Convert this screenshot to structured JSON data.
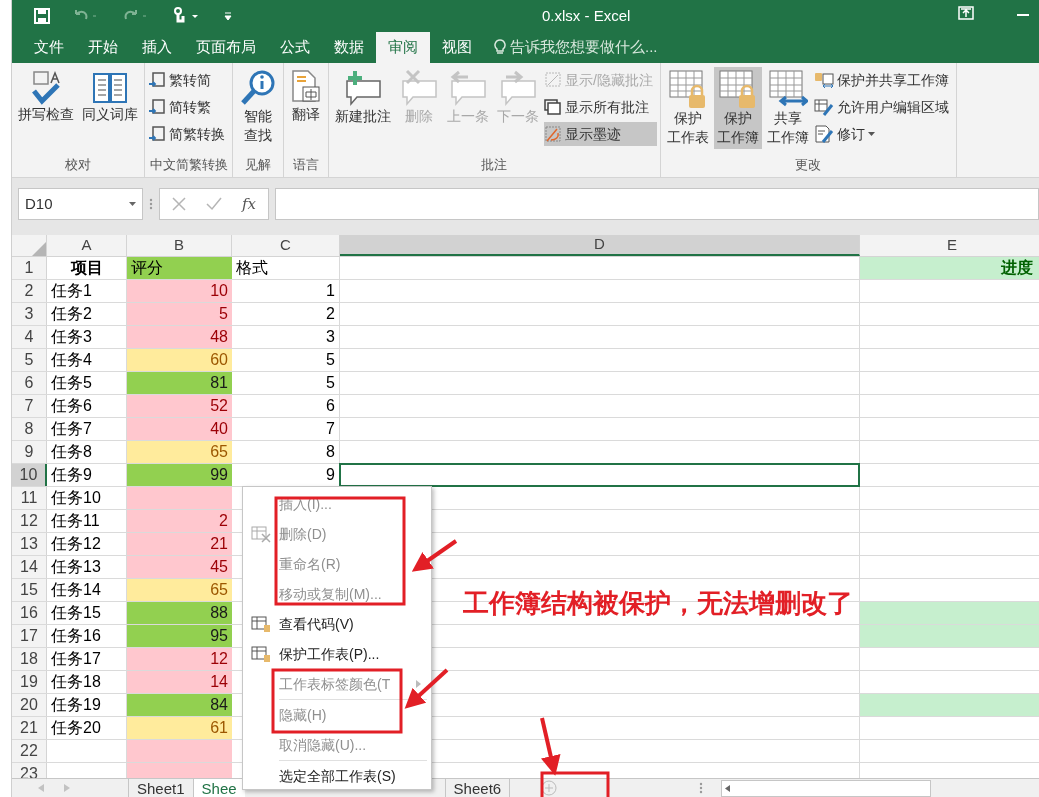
{
  "window": {
    "title": "0.xlsx - Excel"
  },
  "menu_tabs": [
    {
      "label": "文件",
      "selected": false
    },
    {
      "label": "开始",
      "selected": false
    },
    {
      "label": "插入",
      "selected": false
    },
    {
      "label": "页面布局",
      "selected": false
    },
    {
      "label": "公式",
      "selected": false
    },
    {
      "label": "数据",
      "selected": false
    },
    {
      "label": "审阅",
      "selected": true
    },
    {
      "label": "视图",
      "selected": false
    }
  ],
  "tell_me": {
    "placeholder": "告诉我您想要做什么..."
  },
  "ribbon_groups": [
    {
      "label": "校对",
      "buttons": [
        {
          "label": "拼写检查",
          "kind": "large",
          "disabled": false,
          "selected": false
        },
        {
          "label": "同义词库",
          "kind": "large",
          "disabled": false,
          "selected": false
        }
      ]
    },
    {
      "label": "中文简繁转换",
      "buttons": [
        {
          "label": "繁转简",
          "kind": "small",
          "disabled": false,
          "selected": false
        },
        {
          "label": "简转繁",
          "kind": "small",
          "disabled": false,
          "selected": false
        },
        {
          "label": "简繁转换",
          "kind": "small",
          "disabled": false,
          "selected": false
        }
      ]
    },
    {
      "label": "见解",
      "buttons": [
        {
          "label_lines": [
            "智能",
            "查找"
          ],
          "kind": "large",
          "disabled": false,
          "selected": false
        }
      ]
    },
    {
      "label": "语言",
      "buttons": [
        {
          "label": "翻译",
          "kind": "large",
          "disabled": false,
          "selected": false
        }
      ]
    },
    {
      "label": "批注",
      "buttons": [
        {
          "label": "新建批注",
          "kind": "large",
          "disabled": false,
          "selected": false
        },
        {
          "label": "删除",
          "kind": "large",
          "disabled": true,
          "selected": false
        },
        {
          "label": "上一条",
          "kind": "large",
          "disabled": true,
          "selected": false
        },
        {
          "label": "下一条",
          "kind": "large",
          "disabled": true,
          "selected": false
        },
        {
          "label": "显示/隐藏批注",
          "kind": "small",
          "disabled": true,
          "selected": false
        },
        {
          "label": "显示所有批注",
          "kind": "small",
          "disabled": false,
          "selected": false
        },
        {
          "label": "显示墨迹",
          "kind": "small",
          "disabled": false,
          "selected": true
        }
      ]
    },
    {
      "label": "更改",
      "buttons": [
        {
          "label_lines": [
            "保护",
            "工作表"
          ],
          "kind": "large",
          "disabled": false,
          "selected": false
        },
        {
          "label_lines": [
            "保护",
            "工作簿"
          ],
          "kind": "large",
          "disabled": false,
          "selected": true
        },
        {
          "label_lines": [
            "共享",
            "工作簿"
          ],
          "kind": "large",
          "disabled": false,
          "selected": false
        },
        {
          "label": "保护并共享工作簿",
          "kind": "small",
          "disabled": false,
          "selected": false
        },
        {
          "label": "允许用户编辑区域",
          "kind": "small",
          "disabled": false,
          "selected": false
        },
        {
          "label": "修订",
          "kind": "small-menu",
          "disabled": false,
          "selected": false
        }
      ]
    }
  ],
  "formula_bar": {
    "name_box": "D10",
    "fx": "fx"
  },
  "columns": [
    {
      "label": "A",
      "selected": false
    },
    {
      "label": "B",
      "selected": false
    },
    {
      "label": "C",
      "selected": false
    },
    {
      "label": "D",
      "selected": true
    },
    {
      "label": "E",
      "selected": false
    }
  ],
  "header_row": {
    "num": "1",
    "a": "项目",
    "b": "评分",
    "c": "格式",
    "e": "进度"
  },
  "rows": [
    {
      "num": "2",
      "name": "任务1",
      "score": "10",
      "color": "#ffc7ce",
      "format": "1",
      "e_filled": false,
      "selected": false
    },
    {
      "num": "3",
      "name": "任务2",
      "score": "5",
      "color": "#ffc7ce",
      "format": "2",
      "e_filled": false,
      "selected": false
    },
    {
      "num": "4",
      "name": "任务3",
      "score": "48",
      "color": "#ffc7ce",
      "format": "3",
      "e_filled": false,
      "selected": false
    },
    {
      "num": "5",
      "name": "任务4",
      "score": "60",
      "color": "#ffeb9c",
      "format": "5",
      "e_filled": false,
      "selected": false
    },
    {
      "num": "6",
      "name": "任务5",
      "score": "81",
      "color": "#92d050",
      "format": "5",
      "e_filled": false,
      "selected": false
    },
    {
      "num": "7",
      "name": "任务6",
      "score": "52",
      "color": "#ffc7ce",
      "format": "6",
      "e_filled": false,
      "selected": false
    },
    {
      "num": "8",
      "name": "任务7",
      "score": "40",
      "color": "#ffc7ce",
      "format": "7",
      "e_filled": false,
      "selected": false
    },
    {
      "num": "9",
      "name": "任务8",
      "score": "65",
      "color": "#ffeb9c",
      "format": "8",
      "e_filled": false,
      "selected": false
    },
    {
      "num": "10",
      "name": "任务9",
      "score": "99",
      "color": "#92d050",
      "format": "9",
      "e_filled": false,
      "selected": true
    },
    {
      "num": "11",
      "name": "任务10",
      "color": "#ffc7ce",
      "e_filled": false,
      "selected": false
    },
    {
      "num": "12",
      "name": "任务11",
      "score": "2",
      "color": "#ffc7ce",
      "e_filled": false,
      "selected": false
    },
    {
      "num": "13",
      "name": "任务12",
      "score": "21",
      "color": "#ffc7ce",
      "e_filled": false,
      "selected": false
    },
    {
      "num": "14",
      "name": "任务13",
      "score": "45",
      "color": "#ffc7ce",
      "e_filled": false,
      "selected": false
    },
    {
      "num": "15",
      "name": "任务14",
      "score": "65",
      "color": "#ffeb9c",
      "e_filled": false,
      "selected": false
    },
    {
      "num": "16",
      "name": "任务15",
      "score": "88",
      "color": "#92d050",
      "e_filled": true,
      "selected": false
    },
    {
      "num": "17",
      "name": "任务16",
      "score": "95",
      "color": "#92d050",
      "e_filled": true,
      "selected": false
    },
    {
      "num": "18",
      "name": "任务17",
      "score": "12",
      "color": "#ffc7ce",
      "e_filled": false,
      "selected": false
    },
    {
      "num": "19",
      "name": "任务18",
      "score": "14",
      "color": "#ffc7ce",
      "e_filled": false,
      "selected": false
    },
    {
      "num": "20",
      "name": "任务19",
      "score": "84",
      "color": "#92d050",
      "e_filled": true,
      "selected": false
    },
    {
      "num": "21",
      "name": "任务20",
      "score": "61",
      "color": "#ffeb9c",
      "e_filled": false,
      "selected": false
    },
    {
      "num": "22",
      "color": "#ffc7ce",
      "e_filled": false,
      "selected": false
    },
    {
      "num": "23",
      "color": "#ffc7ce",
      "e_filled": false,
      "selected": false
    }
  ],
  "context_menu": [
    {
      "kind": "item",
      "label": "插入(I)...",
      "disabled": true,
      "submenu": false
    },
    {
      "kind": "item",
      "label": "删除(D)",
      "disabled": true,
      "submenu": false,
      "icon": true
    },
    {
      "kind": "item",
      "label": "重命名(R)",
      "disabled": true,
      "submenu": false
    },
    {
      "kind": "item",
      "label": "移动或复制(M)...",
      "disabled": true,
      "submenu": false
    },
    {
      "kind": "item",
      "label": "查看代码(V)",
      "disabled": false,
      "submenu": false,
      "icon": true
    },
    {
      "kind": "item",
      "label": "保护工作表(P)...",
      "disabled": false,
      "submenu": false,
      "icon": true
    },
    {
      "kind": "item",
      "label": "工作表标签颜色(T",
      "disabled": true,
      "submenu": true
    },
    {
      "kind": "separator"
    },
    {
      "kind": "item",
      "label": "隐藏(H)",
      "disabled": true,
      "submenu": false
    },
    {
      "kind": "item",
      "label": "取消隐藏(U)...",
      "disabled": true,
      "submenu": false
    },
    {
      "kind": "separator"
    },
    {
      "kind": "item",
      "label": "选定全部工作表(S)",
      "disabled": false,
      "submenu": false
    }
  ],
  "sheet_tabs": [
    {
      "label": "Sheet1",
      "selected": false
    },
    {
      "label": "Shee",
      "selected": true
    },
    {
      "label": "Sheet6",
      "selected": false
    }
  ],
  "annotation": {
    "text": "工作簿结构被保护，无法增删改了"
  }
}
